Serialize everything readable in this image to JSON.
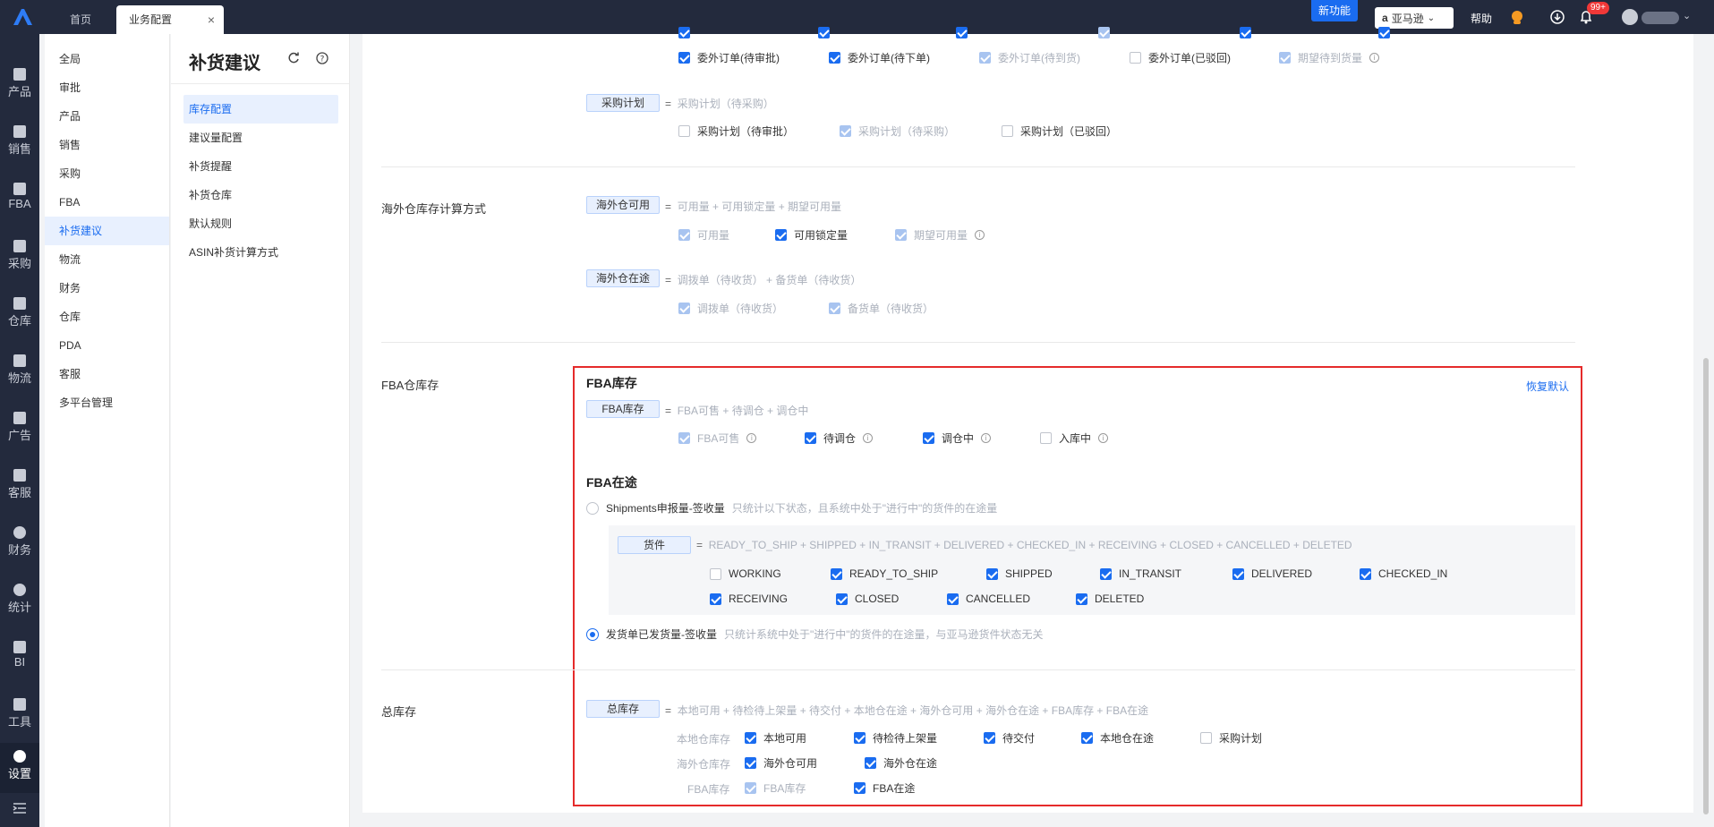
{
  "topbar": {
    "tabs": [
      "首页",
      "业务配置"
    ],
    "new_feature": "新功能",
    "shop": "亚马逊",
    "help": "帮助",
    "badge": "99+"
  },
  "rail": [
    {
      "label": "产品",
      "icon": "product-icon"
    },
    {
      "label": "销售",
      "icon": "sales-icon"
    },
    {
      "label": "FBA",
      "icon": "fba-icon"
    },
    {
      "label": "采购",
      "icon": "cart-icon"
    },
    {
      "label": "仓库",
      "icon": "warehouse-icon"
    },
    {
      "label": "物流",
      "icon": "truck-icon"
    },
    {
      "label": "广告",
      "icon": "ad-icon"
    },
    {
      "label": "客服",
      "icon": "mail-icon"
    },
    {
      "label": "财务",
      "icon": "yen-icon"
    },
    {
      "label": "统计",
      "icon": "pie-icon"
    },
    {
      "label": "BI",
      "icon": "bi-icon"
    },
    {
      "label": "工具",
      "icon": "tool-icon"
    },
    {
      "label": "设置",
      "icon": "gear-icon"
    }
  ],
  "submenu": [
    "全局",
    "审批",
    "产品",
    "销售",
    "采购",
    "FBA",
    "补货建议",
    "物流",
    "财务",
    "仓库",
    "PDA",
    "客服",
    "多平台管理"
  ],
  "tmenu": {
    "title": "补货建议",
    "items": [
      "库存配置",
      "建议量配置",
      "补货提醒",
      "补货仓库",
      "默认规则",
      "ASIN补货计算方式"
    ]
  },
  "s1": {
    "row1": [
      "委外订单(待审批)",
      "委外订单(待下单)",
      "委外订单(待到货)",
      "委外订单(已驳回)",
      "期望待到货量"
    ],
    "plan_tag": "采购计划",
    "plan_formula": "采购计划（待采购）",
    "plan_row": [
      "采购计划（待审批）",
      "采购计划（待采购）",
      "采购计划（已驳回）"
    ]
  },
  "s2": {
    "label": "海外仓库存计算方式",
    "avail_tag": "海外仓可用",
    "avail_formula": "可用量 + 可用锁定量 + 期望可用量",
    "avail_row": [
      "可用量",
      "可用锁定量",
      "期望可用量"
    ],
    "transit_tag": "海外仓在途",
    "transit_formula": "调拨单（待收货） + 备货单（待收货）",
    "transit_row": [
      "调拨单（待收货）",
      "备货单（待收货）"
    ]
  },
  "s3": {
    "label": "FBA仓库存",
    "h1": "FBA库存",
    "restore": "恢复默认",
    "fba_tag": "FBA库存",
    "fba_formula": "FBA可售 + 待调仓 + 调仓中",
    "fba_row": [
      "FBA可售",
      "待调仓",
      "调仓中",
      "入库中"
    ],
    "h2": "FBA在途",
    "radio1": "Shipments申报量-签收量",
    "radio1_hint": "只统计以下状态，且系统中处于\"进行中\"的货件的在途量",
    "ship_tag": "货件",
    "ship_formula": "READY_TO_SHIP + SHIPPED + IN_TRANSIT + DELIVERED + CHECKED_IN + RECEIVING + CLOSED + CANCELLED + DELETED",
    "ship_row1": [
      "WORKING",
      "READY_TO_SHIP",
      "SHIPPED",
      "IN_TRANSIT",
      "DELIVERED",
      "CHECKED_IN"
    ],
    "ship_row2": [
      "RECEIVING",
      "CLOSED",
      "CANCELLED",
      "DELETED"
    ],
    "radio2": "发货单已发货量-签收量",
    "radio2_hint": "只统计系统中处于\"进行中\"的货件的在途量，与亚马逊货件状态无关"
  },
  "s4": {
    "label": "总库存",
    "tag": "总库存",
    "formula": "本地可用 + 待检待上架量 + 待交付 + 本地仓在途 + 海外仓可用 + 海外仓在途 + FBA库存 + FBA在途",
    "local_label": "本地仓库存",
    "local_row": [
      "本地可用",
      "待检待上架量",
      "待交付",
      "本地仓在途",
      "采购计划"
    ],
    "overseas_label": "海外仓库存",
    "overseas_row": [
      "海外仓可用",
      "海外仓在途"
    ],
    "fba_label": "FBA库存",
    "fba_row": [
      "FBA库存",
      "FBA在途"
    ]
  },
  "colors": {
    "accent": "#1a6cf0",
    "highlight": "#e52b2b",
    "topbar": "#232a3d"
  }
}
